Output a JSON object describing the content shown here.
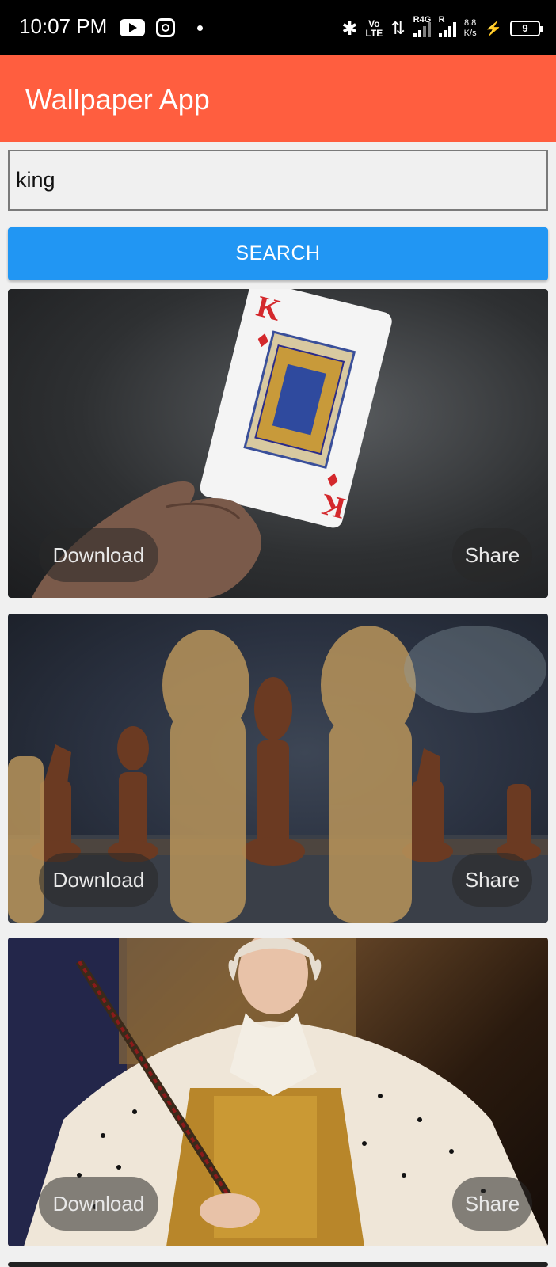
{
  "status_bar": {
    "time": "10:07 PM",
    "volte_top": "Vo",
    "volte_bottom": "LTE",
    "sim1_label": "R4G",
    "sim2_label": "R",
    "speed_value": "8.8",
    "speed_unit": "K/s",
    "battery_level": "9",
    "icons": [
      "youtube-icon",
      "instagram-icon",
      "bluetooth-icon",
      "data-arrows-icon",
      "signal-icon",
      "charging-icon",
      "battery-icon"
    ]
  },
  "app_bar": {
    "title": "Wallpaper App",
    "color": "#ff5e3f"
  },
  "search": {
    "value": "king",
    "button_label": "SEARCH",
    "button_color": "#2196f3"
  },
  "results": [
    {
      "subject": "king of diamonds playing card",
      "download_label": "Download",
      "share_label": "Share"
    },
    {
      "subject": "chess king pieces",
      "download_label": "Download",
      "share_label": "Share"
    },
    {
      "subject": "portrait of a king in royal robes",
      "download_label": "Download",
      "share_label": "Share"
    }
  ]
}
